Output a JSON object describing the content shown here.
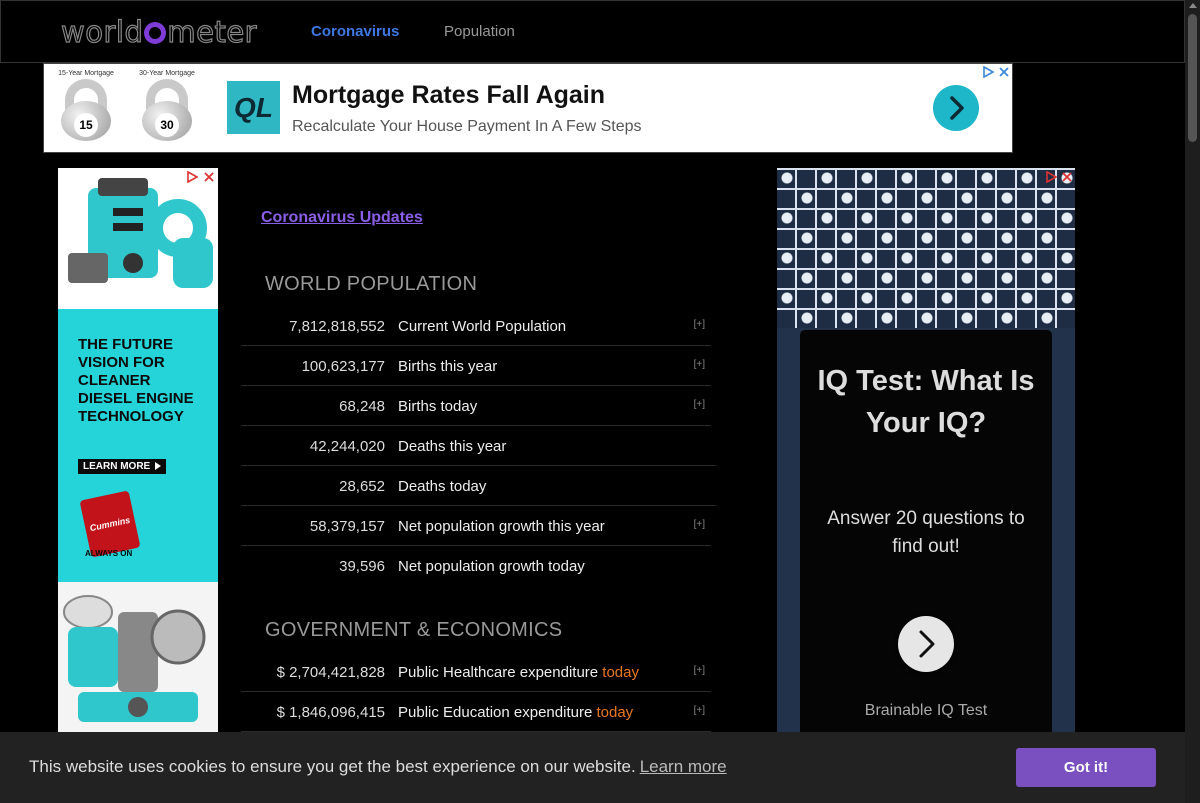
{
  "header": {
    "logo_text": "worldometer",
    "nav": [
      {
        "label": "Coronavirus"
      },
      {
        "label": "Population"
      }
    ]
  },
  "banner_ad": {
    "kettlebell_1_label": "15-Year Mortgage",
    "kettlebell_1_number": "15",
    "kettlebell_2_label": "30-Year Mortgage",
    "kettlebell_2_number": "30",
    "logo_text": "QL",
    "title": "Mortgage Rates Fall Again",
    "subtitle": "Recalculate Your House Payment In A Few Steps"
  },
  "left_ad": {
    "headline": "THE FUTURE VISION FOR CLEANER DIESEL ENGINE TECHNOLOGY",
    "cta": "LEARN MORE",
    "brand": "Cummins",
    "tagline": "ALWAYS ON"
  },
  "main": {
    "updates_link": "Coronavirus Updates",
    "world_population": {
      "title": "WORLD POPULATION",
      "rows": [
        {
          "value": "7,812,818,552",
          "label": "Current World Population",
          "expand": "[+]"
        },
        {
          "value": "100,623,177",
          "label": "Births this year",
          "expand": "[+]"
        },
        {
          "value": "68,248",
          "label": "Births today",
          "expand": "[+]"
        },
        {
          "value": "42,244,020",
          "label": "Deaths this year",
          "expand": ""
        },
        {
          "value": "28,652",
          "label": "Deaths today",
          "expand": ""
        },
        {
          "value": "58,379,157",
          "label": "Net population growth this year",
          "expand": "[+]"
        },
        {
          "value": "39,596",
          "label": "Net population growth today",
          "expand": ""
        }
      ]
    },
    "gov_econ": {
      "title": "GOVERNMENT & ECONOMICS",
      "rows": [
        {
          "value": "$ 2,704,421,828",
          "label": "Public Healthcare expenditure",
          "today": "today",
          "expand": "[+]"
        },
        {
          "value": "$ 1,846,096,415",
          "label": "Public Education expenditure",
          "today": "today",
          "expand": "[+]"
        }
      ]
    }
  },
  "right_ad": {
    "title": "IQ Test: What Is Your IQ?",
    "subtitle": "Answer 20 questions to find out!",
    "brand": "Brainable IQ Test"
  },
  "cookie": {
    "text": "This website uses cookies to ensure you get the best experience on our website.",
    "learn_more": "Learn more",
    "button": "Got it!"
  },
  "colors": {
    "accent_purple": "#7a4fbf",
    "nav_active": "#3e77e3",
    "today_orange": "#e87722",
    "ad_teal": "#24d4d8"
  }
}
